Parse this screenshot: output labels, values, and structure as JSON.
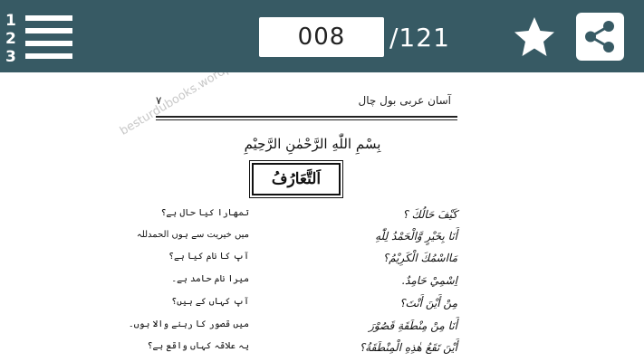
{
  "toolbar": {
    "current_page": "008",
    "total_pages": "/121",
    "icons": {
      "toc": "numbered-list-icon",
      "favorite": "star-icon",
      "share": "share-icon"
    }
  },
  "page": {
    "page_number": "۷",
    "book_title": "آسان عربی بول چال",
    "watermark": "besturdubooks.wordpress.com",
    "basmala": "بِسْمِ اللّٰهِ الرَّحْمٰنِ الرَّحِيْمِ",
    "lesson_title": "اَلتَّعَارُفُ",
    "dialogue": [
      {
        "arabic": "كَيْفَ حَالُكَ ؟",
        "urdu": "تمھارا کیا حال ہے؟"
      },
      {
        "arabic": "أَنَا بِخَيْرٍ وَّالْحَمْدُ لِلّٰهِ",
        "urdu": "میں خیریت سے ہوں الحمدللہ"
      },
      {
        "arabic": "مَااسْمُكَ الْكَرِيْمُ؟",
        "urdu": "آپ کا نام کیا ہے؟"
      },
      {
        "arabic": "اِسْمِيْ حَامِدٌ.",
        "urdu": "میرا نام حامد ہے۔"
      },
      {
        "arabic": "مِنْ أَيْنَ أَنْتَ؟",
        "urdu": "آپ کہاں کے ہیں؟"
      },
      {
        "arabic": "أَنَا مِنْ مِنْطَقَةِ قَصُوْرَ",
        "urdu": "میں قصور کا رہنے والا ہوں۔"
      },
      {
        "arabic": "أَيْنَ تَقَعُ هٰذِهِ الْمِنْطَقَةُ؟",
        "urdu": "یہ علاقہ کہاں واقع ہے؟"
      }
    ]
  },
  "colors": {
    "toolbar_bg": "#375a64",
    "toolbar_fg": "#ffffff"
  }
}
